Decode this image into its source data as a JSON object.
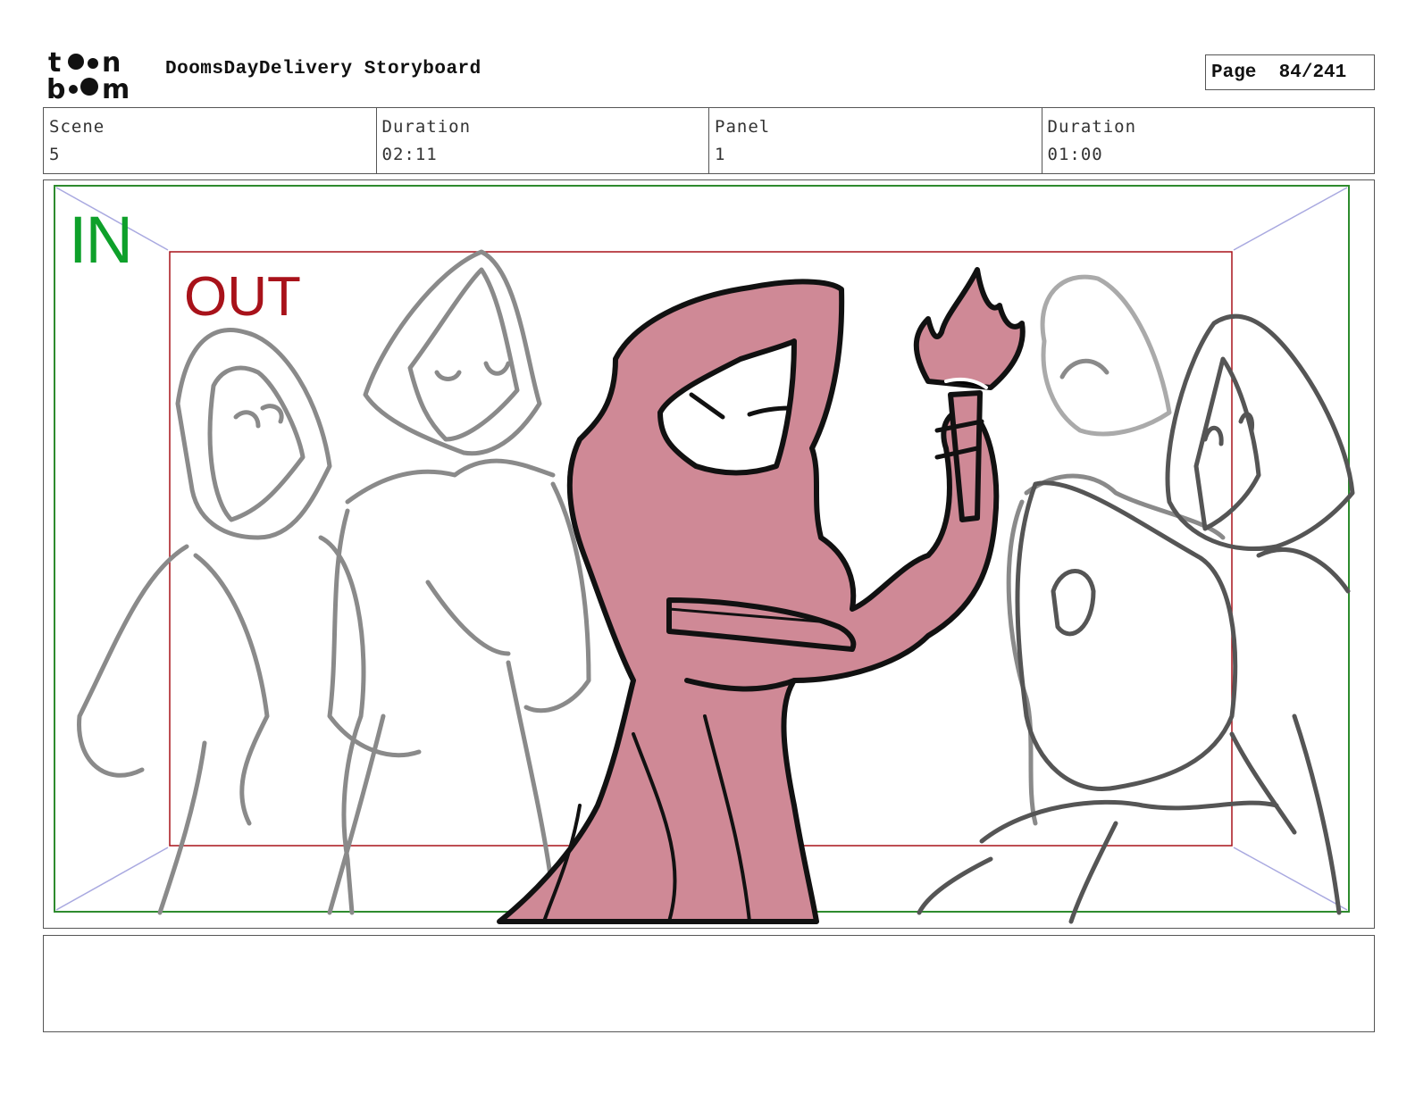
{
  "header": {
    "logo_text": "toonboom",
    "title": "DoomsDayDelivery Storyboard",
    "page_label": "Page",
    "page_value": "84/241"
  },
  "info": {
    "scene_label": "Scene",
    "scene_value": "5",
    "scene_duration_label": "Duration",
    "scene_duration_value": "02:11",
    "panel_label": "Panel",
    "panel_value": "1",
    "panel_duration_label": "Duration",
    "panel_duration_value": "01:00"
  },
  "panel": {
    "in_label": "IN",
    "out_label": "OUT",
    "colors": {
      "in_frame": "#2e8b2e",
      "out_frame": "#a8121a",
      "character_fill": "#cf8996",
      "ink": "#111111",
      "sketch_gray": "#8a8a8a"
    }
  },
  "notes": {
    "text": ""
  }
}
